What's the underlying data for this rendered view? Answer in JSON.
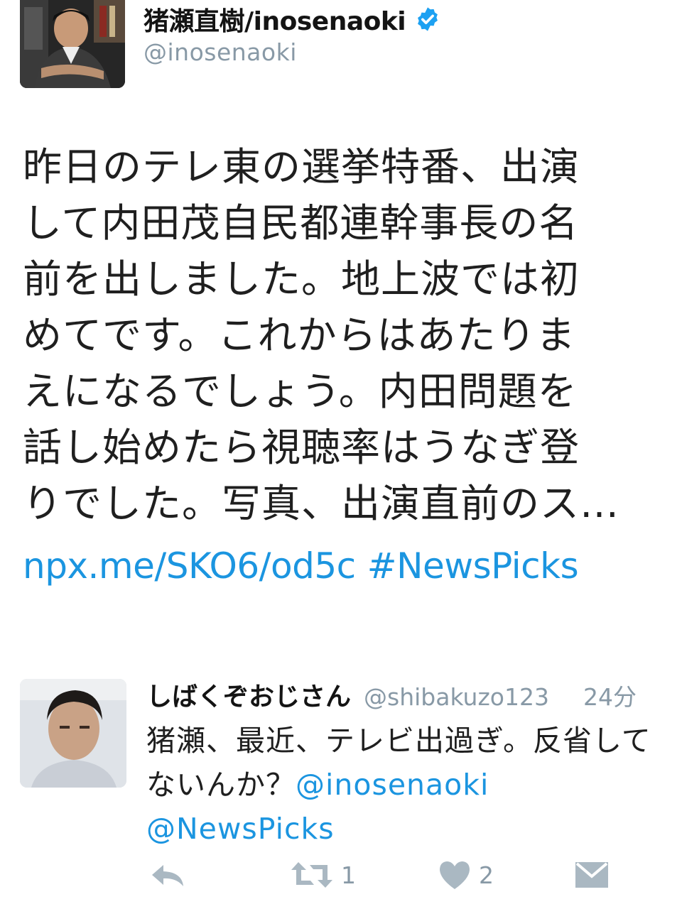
{
  "main_tweet": {
    "author_name": "猪瀬直樹/inosenaoki",
    "handle": "@inosenaoki",
    "verified": true,
    "text_lines": [
      "昨日のテレ東の選挙特番、出演",
      "して内田茂自民都連幹事長の名",
      "前を出しました。地上波では初",
      "めてです。これからはあたりま",
      "えになるでしょう。内田問題を",
      "話し始めたら視聴率はうなぎ登",
      "りでした。写真、出演直前のス…"
    ],
    "link": "npx.me/SKO6/od5c",
    "hashtag": "#NewsPicks"
  },
  "reply": {
    "author_name": "しばくぞおじさん",
    "handle": "@shibakuzo123",
    "time": "24分",
    "text": "猪瀬、最近、テレビ出過ぎ。反省してないんか？",
    "mentions": [
      "@inosenaoki",
      "@NewsPicks"
    ]
  },
  "actions": {
    "reply_icon": "reply-icon",
    "retweet_icon": "retweet-icon",
    "retweet_count": "1",
    "like_icon": "heart-icon",
    "like_count": "2",
    "dm_icon": "envelope-icon"
  },
  "colors": {
    "link": "#1b95e0",
    "secondary_text": "#8899a6",
    "icon": "#aab8c2"
  }
}
